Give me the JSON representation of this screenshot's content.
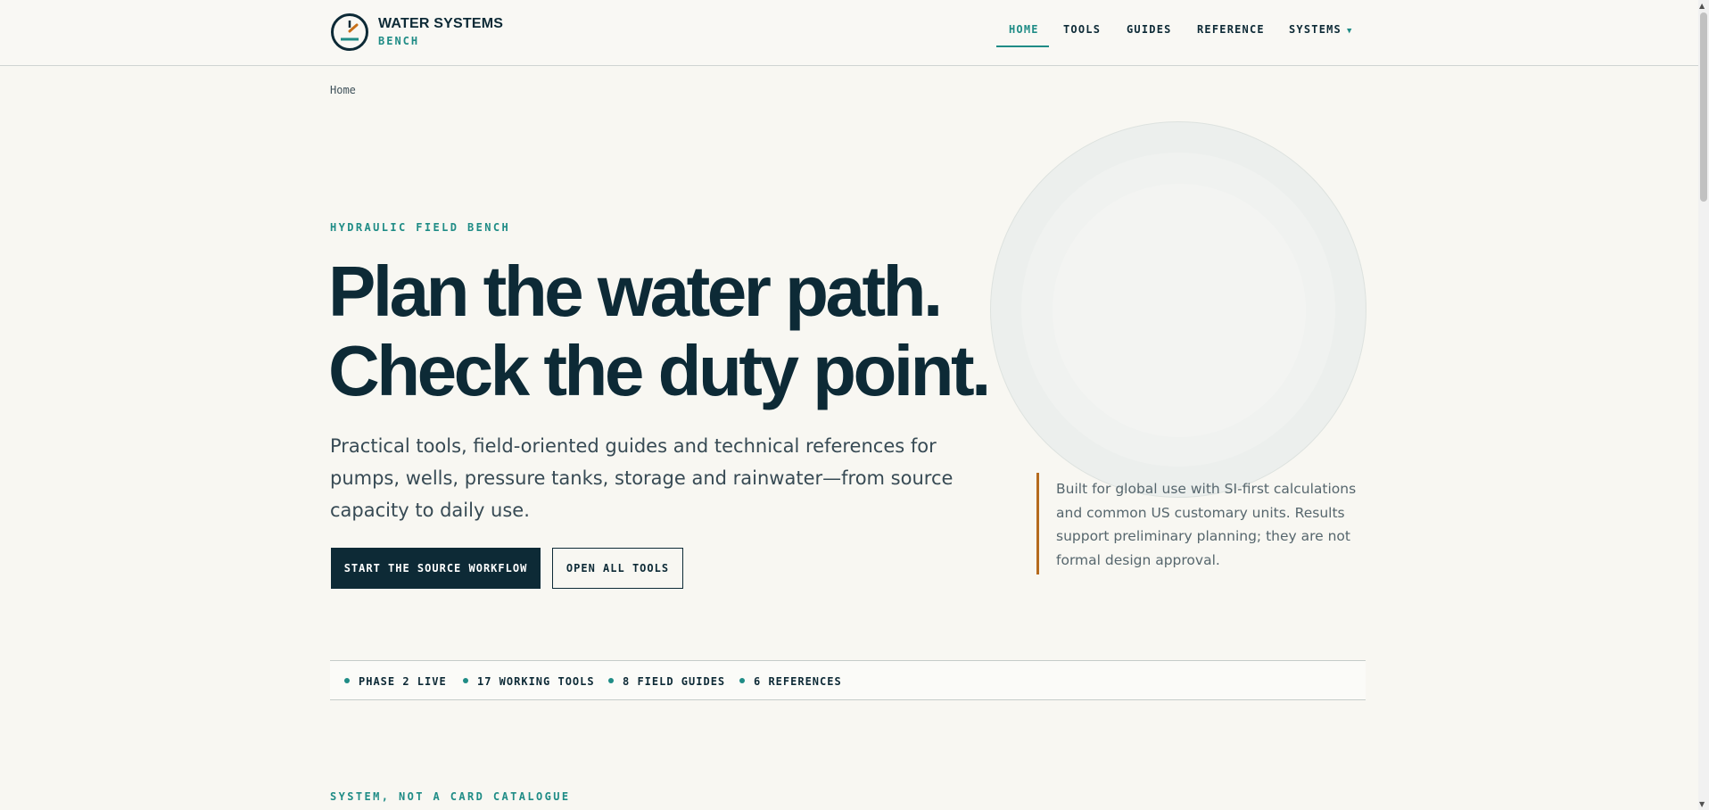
{
  "header": {
    "brand_title": "WATER SYSTEMS",
    "brand_sub": "BENCH",
    "logo_icon": "gauge-icon",
    "nav": [
      {
        "label": "HOME",
        "active": true
      },
      {
        "label": "TOOLS"
      },
      {
        "label": "GUIDES"
      },
      {
        "label": "REFERENCE"
      },
      {
        "label": "SYSTEMS",
        "dropdown_icon": "caret-down-icon"
      }
    ]
  },
  "breadcrumb": "Home",
  "hero": {
    "eyebrow": "HYDRAULIC FIELD BENCH",
    "headline_1": "Plan the water path.",
    "headline_2": "Check the duty point.",
    "lede": "Practical tools, field-oriented guides and technical references for pumps, wells, pressure tanks, storage and rainwater—from source capacity to daily use.",
    "primary_cta": "START THE SOURCE WORKFLOW",
    "secondary_cta": "OPEN ALL TOOLS",
    "note": "Built for global use with SI-first calculations and common US customary units. Results support preliminary planning; they are not formal design approval."
  },
  "status": [
    "PHASE 2 LIVE",
    "17 WORKING TOOLS",
    "8 FIELD GUIDES",
    "6 REFERENCES"
  ],
  "next_section_eyebrow": "SYSTEM, NOT A CARD CATALOGUE",
  "colors": {
    "ink": "#0d2a36",
    "teal": "#1f8c86",
    "accent": "#b56a1e",
    "background": "#f8f7f2"
  }
}
